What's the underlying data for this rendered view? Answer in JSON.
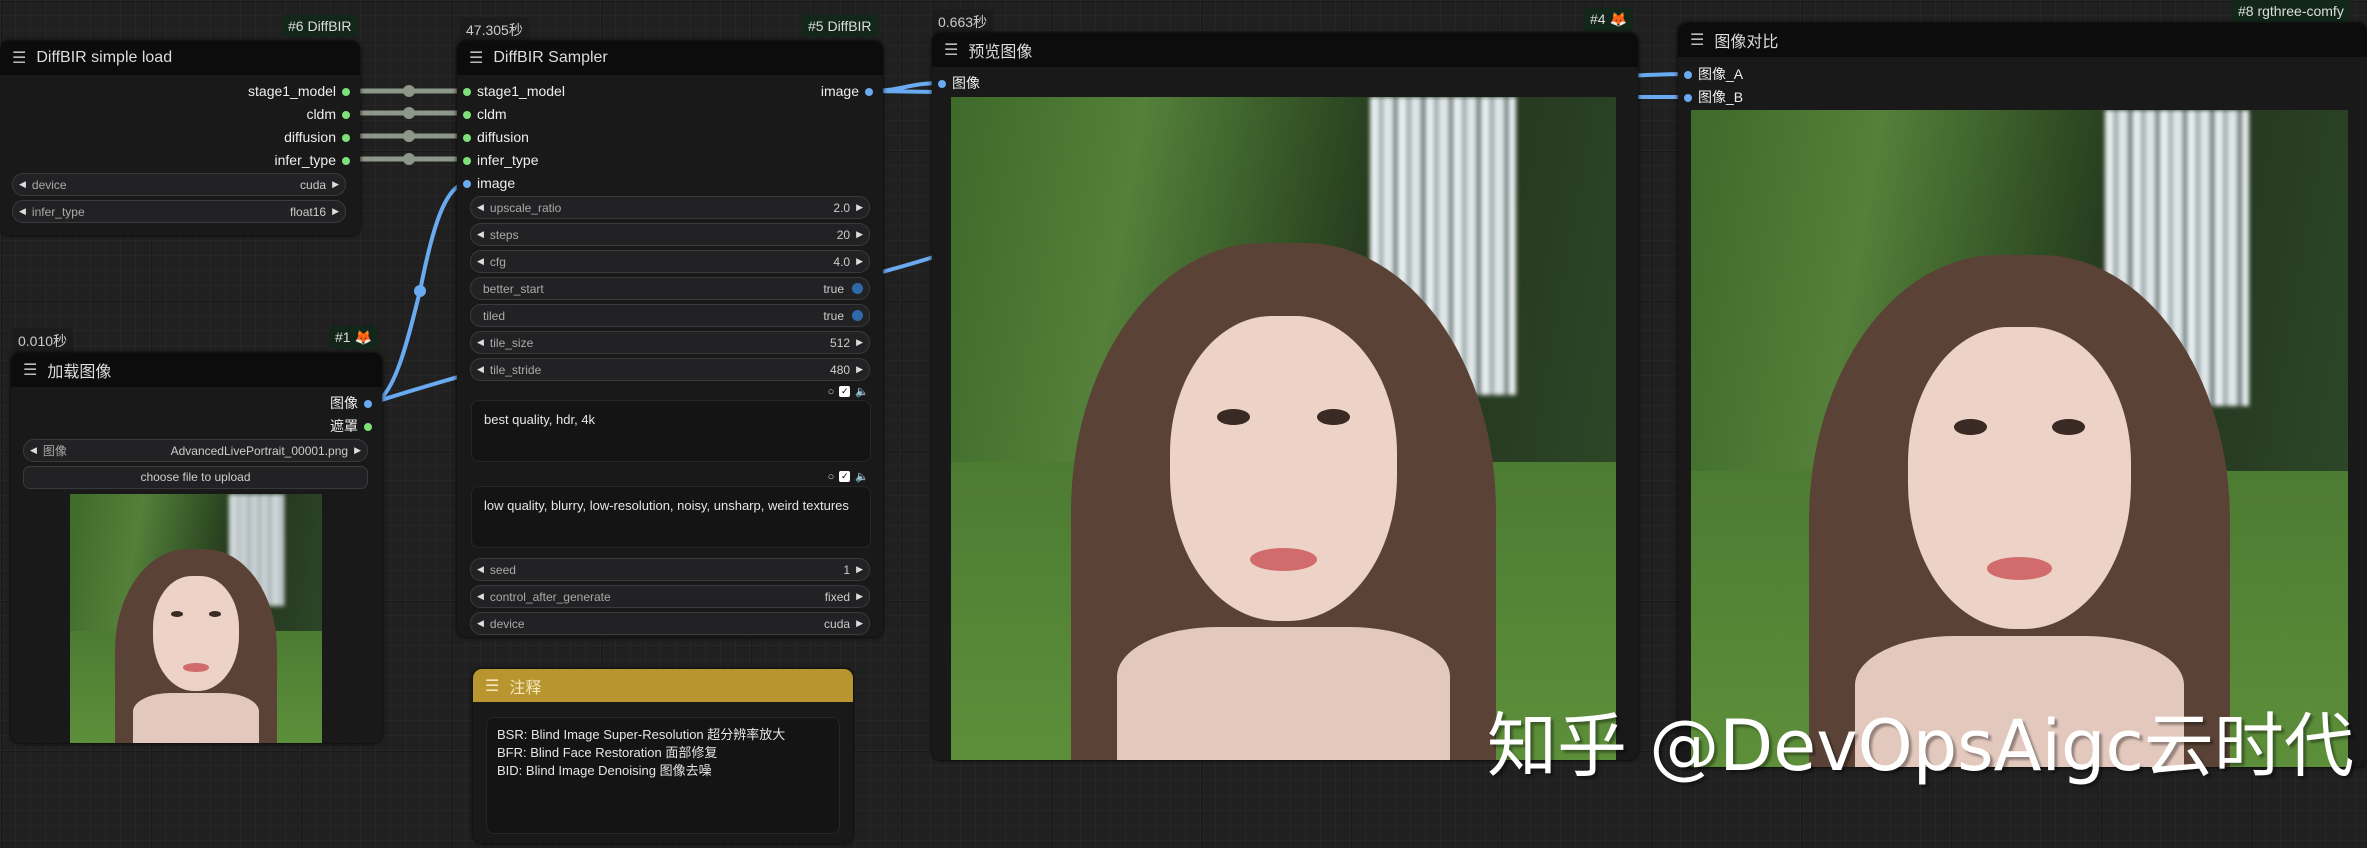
{
  "nodes": {
    "simple_load": {
      "badge": "#6 DiffBIR",
      "title": "DiffBIR simple load",
      "outputs": [
        "stage1_model",
        "cldm",
        "diffusion",
        "infer_type"
      ],
      "widgets": [
        {
          "label": "device",
          "value": "cuda"
        },
        {
          "label": "infer_type",
          "value": "float16"
        }
      ]
    },
    "sampler": {
      "timing": "47.305秒",
      "badge": "#5 DiffBIR",
      "title": "DiffBIR Sampler",
      "inputs": [
        "stage1_model",
        "cldm",
        "diffusion",
        "infer_type",
        "image"
      ],
      "output": "image",
      "widgets": [
        {
          "label": "upscale_ratio",
          "value": "2.0",
          "type": "number"
        },
        {
          "label": "steps",
          "value": "20",
          "type": "number"
        },
        {
          "label": "cfg",
          "value": "4.0",
          "type": "number"
        },
        {
          "label": "better_start",
          "value": "true",
          "type": "toggle"
        },
        {
          "label": "tiled",
          "value": "true",
          "type": "toggle"
        },
        {
          "label": "tile_size",
          "value": "512",
          "type": "number"
        },
        {
          "label": "tile_stride",
          "value": "480",
          "type": "number"
        }
      ],
      "positive_prompt": "best quality, hdr, 4k",
      "negative_prompt": "low quality, blurry, low-resolution, noisy, unsharp, weird textures",
      "widgets_bottom": [
        {
          "label": "seed",
          "value": "1",
          "type": "number"
        },
        {
          "label": "control_after_generate",
          "value": "fixed",
          "type": "number"
        },
        {
          "label": "device",
          "value": "cuda",
          "type": "number"
        }
      ]
    },
    "load_image": {
      "timing": "0.010秒",
      "badge": "#1",
      "title": "加载图像",
      "outputs": [
        "图像",
        "遮罩"
      ],
      "image_widget": {
        "label": "图像",
        "value": "AdvancedLivePortrait_00001.png"
      },
      "upload_label": "choose file to upload"
    },
    "note": {
      "title": "注释",
      "lines": [
        "BSR: Blind Image Super-Resolution 超分辨率放大",
        "BFR: Blind Face Restoration 面部修复",
        "BID: Blind Image Denoising 图像去噪"
      ]
    },
    "preview": {
      "timing": "0.663秒",
      "badge": "#4",
      "title": "预览图像",
      "input": "图像"
    },
    "compare": {
      "badge": "#8 rgthree-comfy",
      "title": "图像对比",
      "inputs": [
        "图像_A",
        "图像_B"
      ]
    }
  },
  "watermark": "知乎 @DevOpsAigc云时代",
  "colors": {
    "model_slot": "#7ee07a",
    "image_slot": "#6aaaf0",
    "note_header": "#b8952f",
    "link_image": "#6aaaf0",
    "link_model": "#a0aa9c"
  }
}
